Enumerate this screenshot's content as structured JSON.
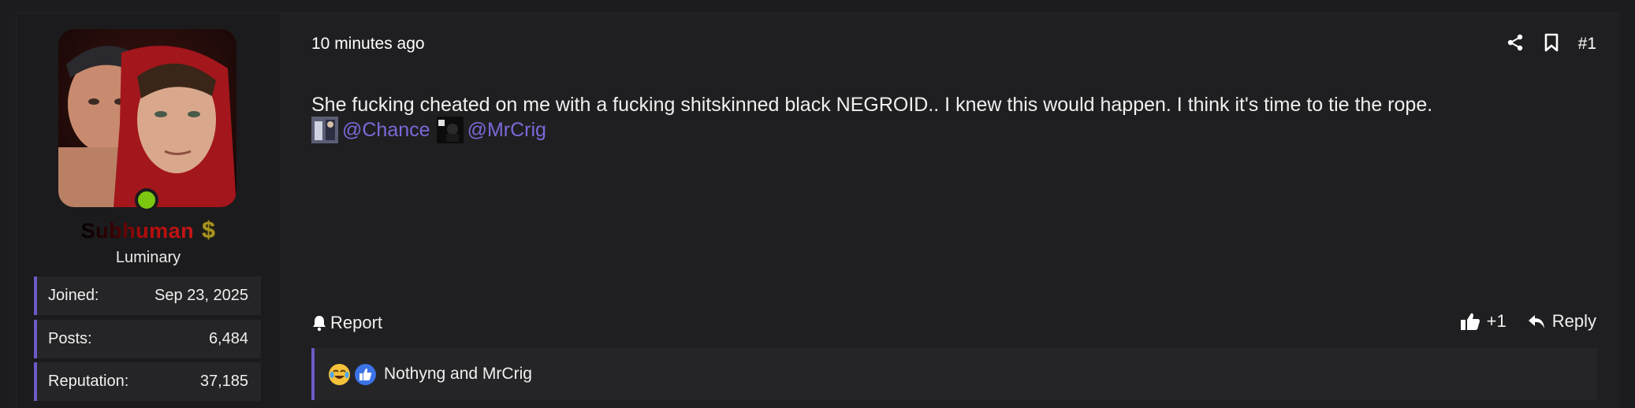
{
  "user": {
    "name": "Subhuman",
    "title": "Luminary",
    "online": true,
    "stats": [
      {
        "label": "Joined:",
        "value": "Sep 23, 2025"
      },
      {
        "label": "Posts:",
        "value": "6,484"
      },
      {
        "label": "Reputation:",
        "value": "37,185"
      }
    ]
  },
  "post": {
    "timestamp": "10 minutes ago",
    "number": "#1",
    "body": "She fucking cheated on me with a fucking shitskinned black NEGROID.. I knew this would happen. I think it's time to tie the rope.",
    "mentions": [
      "@Chance",
      "@MrCrig"
    ]
  },
  "actions": {
    "report": "Report",
    "like_count": "+1",
    "reply": "Reply"
  },
  "reactions": {
    "summary": "Nothyng and MrCrig"
  },
  "colors": {
    "accent": "#6a5bc7",
    "mention": "#7a69d9",
    "online": "#7cc70f",
    "username_red": "#c61616"
  }
}
